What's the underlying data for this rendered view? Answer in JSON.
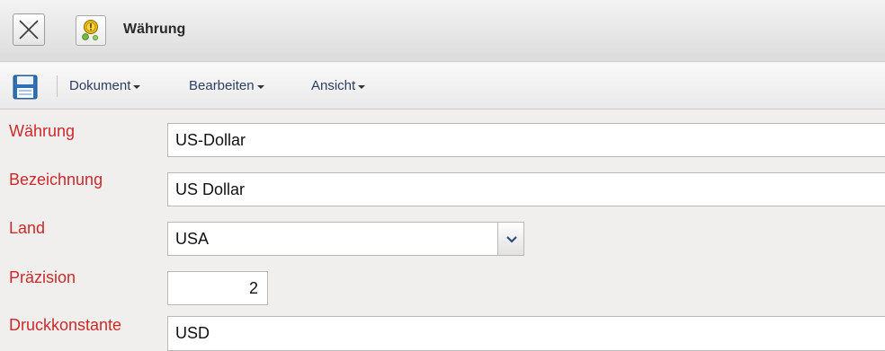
{
  "window": {
    "title": "Währung",
    "close_icon": "close-icon",
    "app_icon": "currency-app-icon"
  },
  "toolbar": {
    "save_icon": "save-icon",
    "menus": [
      {
        "label": "Dokument"
      },
      {
        "label": "Bearbeiten"
      },
      {
        "label": "Ansicht"
      }
    ]
  },
  "form": {
    "currency": {
      "label": "Währung",
      "value": "US-Dollar"
    },
    "description": {
      "label": "Bezeichnung",
      "value": "US Dollar"
    },
    "country": {
      "label": "Land",
      "value": "USA"
    },
    "precision": {
      "label": "Präzision",
      "value": "2"
    },
    "print_constant": {
      "label": "Druckkonstante",
      "value": "USD"
    }
  },
  "colors": {
    "label": "#cc2b2b",
    "menu_text": "#2b3f5e",
    "form_background": "#f1eeee"
  }
}
